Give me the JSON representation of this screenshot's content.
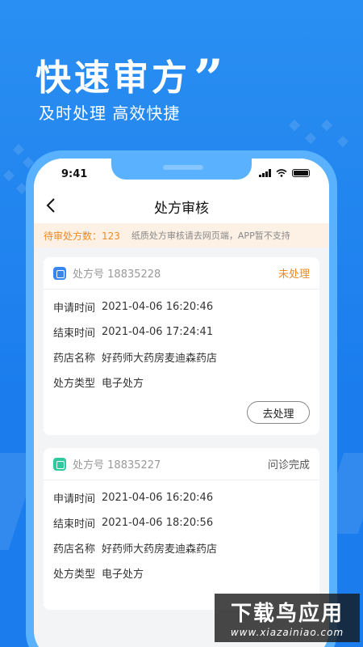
{
  "hero": {
    "title": "快速审方",
    "quote": "”",
    "subtitle": "及时处理 高效快捷"
  },
  "status_bar": {
    "time": "9:41"
  },
  "nav": {
    "title": "处方审核",
    "back_icon": "chevron-left-icon"
  },
  "notice": {
    "count_text": "待审处方数：123",
    "message": "纸质处方审核请去网页端，APP暂不支持"
  },
  "labels": {
    "rx_no": "处方号",
    "apply_time": "申请时间",
    "end_time": "结束时间",
    "pharmacy": "药店名称",
    "rx_type": "处方类型"
  },
  "prescriptions": [
    {
      "number": "18835228",
      "status": "未处理",
      "apply_time": "2021-04-06  16:20:46",
      "end_time": "2021-04-06  17:24:41",
      "pharmacy": "好药师大药房麦迪森药店",
      "type": "电子处方",
      "action": "去处理",
      "icon_color": "#3a86f0",
      "status_color": "#f08a24"
    },
    {
      "number": "18835227",
      "status": "问诊完成",
      "apply_time": "2021-04-06  16:20:46",
      "end_time": "2021-04-06  18:20:56",
      "pharmacy": "好药师大药房麦迪森药店",
      "type": "电子处方",
      "icon_color": "#2fc9a0",
      "status_color": "#555555"
    }
  ],
  "watermark": {
    "main": "下载鸟应用",
    "url": "www.xiazainiao.com"
  },
  "colors": {
    "background": "#1e84ee",
    "phone_frame": "#5ab2ff",
    "accent_orange": "#f08a24"
  }
}
